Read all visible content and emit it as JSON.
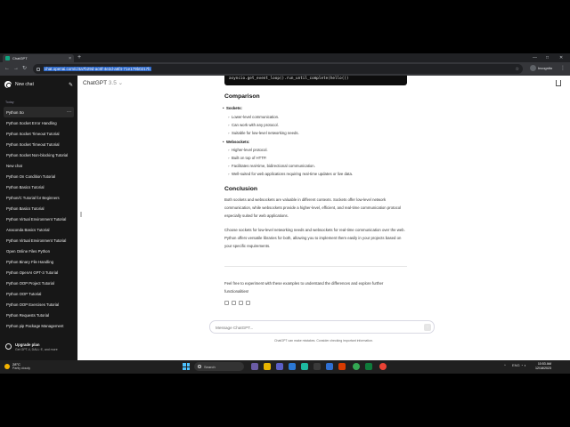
{
  "browser": {
    "tab_title": "ChatGPT",
    "url": "chat.openai.com/c/4a7b29d-ac6f-4e2d-a6f4-71e179b0217b",
    "profile": "Incognito",
    "new_tab": "+",
    "close_tab": "×",
    "back": "←",
    "forward": "→",
    "reload": "↻",
    "star": "☆",
    "menu": "⋮",
    "win_min": "—",
    "win_max": "□",
    "win_close": "✕"
  },
  "sidebar": {
    "new_chat": "New chat",
    "edit_icon": "✎",
    "section": "Today",
    "more": "···",
    "items": [
      {
        "label": "Python So"
      },
      {
        "label": "Python Socket Error Handling"
      },
      {
        "label": "Python Socket Timeout Tutorial"
      },
      {
        "label": "Python Socket Timeout Tutorial"
      },
      {
        "label": "Python Socket Non-blocking Tutorial"
      },
      {
        "label": "New chat"
      },
      {
        "label": "Python On Condition Tutorial"
      },
      {
        "label": "Python Basics Tutorial"
      },
      {
        "label": "Python/C Tutorial for Beginners"
      },
      {
        "label": "Python Basics Tutorial"
      },
      {
        "label": "Python Virtual Environment Tutorial"
      },
      {
        "label": "Anaconda Basics Tutorial"
      },
      {
        "label": "Python Virtual Environment Tutorial"
      },
      {
        "label": "Open Online Files Python"
      },
      {
        "label": "Python Binary File Handling"
      },
      {
        "label": "Python OpenAI GPT-3 Tutorial"
      },
      {
        "label": "Python OOP Project Tutorial"
      },
      {
        "label": "Python OOP Tutorial"
      },
      {
        "label": "Python OOP Exercises Tutorial"
      },
      {
        "label": "Python Requests Tutorial"
      },
      {
        "label": "Python pip Package Management"
      }
    ],
    "upgrade_title": "Upgrade plan",
    "upgrade_sub": "Get GPT-4, DALL·E, and more",
    "user_name": "Manuel mat"
  },
  "main": {
    "model_name": "ChatGPT",
    "model_version": "3.5",
    "model_caret": "⌄",
    "code_line": "asyncio.get_event_loop().run_until_complete(hello())",
    "comparison_heading": "Comparison",
    "sockets_label": "Sockets:",
    "sockets_points": [
      "Lower-level communication.",
      "Can work with any protocol.",
      "Suitable for low-level networking needs."
    ],
    "websockets_label": "Websockets:",
    "websockets_points": [
      "Higher-level protocol.",
      "Built on top of HTTP.",
      "Facilitates real-time, bidirectional communication.",
      "Well-suited for web applications requiring real-time updates or live data."
    ],
    "conclusion_heading": "Conclusion",
    "conclusion_p1": "Both sockets and websockets are valuable in different contexts. Sockets offer low-level network communication, while websockets provide a higher-level, efficient, and real-time communication protocol especially suited for web applications.",
    "conclusion_p2": "Choose sockets for low-level networking needs and websockets for real-time communication over the web. Python offers versatile libraries for both, allowing you to implement them easily in your projects based on your specific requirements.",
    "final_message": "Feel free to experiment with these examples to understand the differences and explore further functionalities!"
  },
  "composer": {
    "placeholder": "Message ChatGPT...",
    "send_icon": "↑",
    "disclaimer": "ChatGPT can make mistakes. Consider checking important information."
  },
  "taskbar": {
    "temperature": "28°C",
    "condition": "Partly cloudy",
    "search_placeholder": "Search",
    "time": "10:53 AM",
    "date": "12/18/2023",
    "tray_chevron": "^",
    "tray_icons": "ENG ◔ ◖"
  }
}
